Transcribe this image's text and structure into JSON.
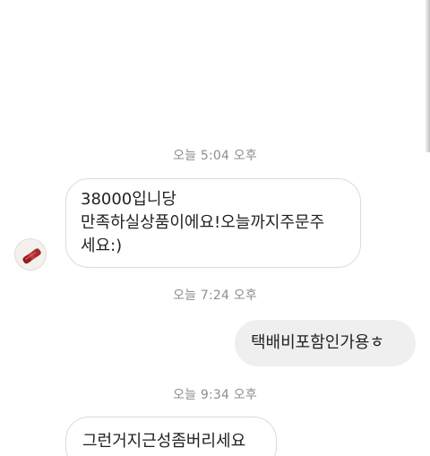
{
  "conversation": {
    "messages": [
      {
        "timestamp": "오늘 5:04 오후",
        "sender": "incoming",
        "text": "38000입니당\n만족하실상품이에요!오늘까지주문주\n세요:)"
      },
      {
        "timestamp": "오늘 7:24 오후",
        "sender": "outgoing",
        "text": "택배비포함인가용ㅎ"
      },
      {
        "timestamp": "오늘 9:34 오후",
        "sender": "incoming",
        "text": "그런거지근성좀버리세요"
      }
    ],
    "avatar_icon": "product-thumbnail-icon"
  },
  "colors": {
    "incoming_bubble_border": "#dbdbdb",
    "outgoing_bubble_bg": "#efefef",
    "timestamp_text": "#8e8e8e"
  }
}
